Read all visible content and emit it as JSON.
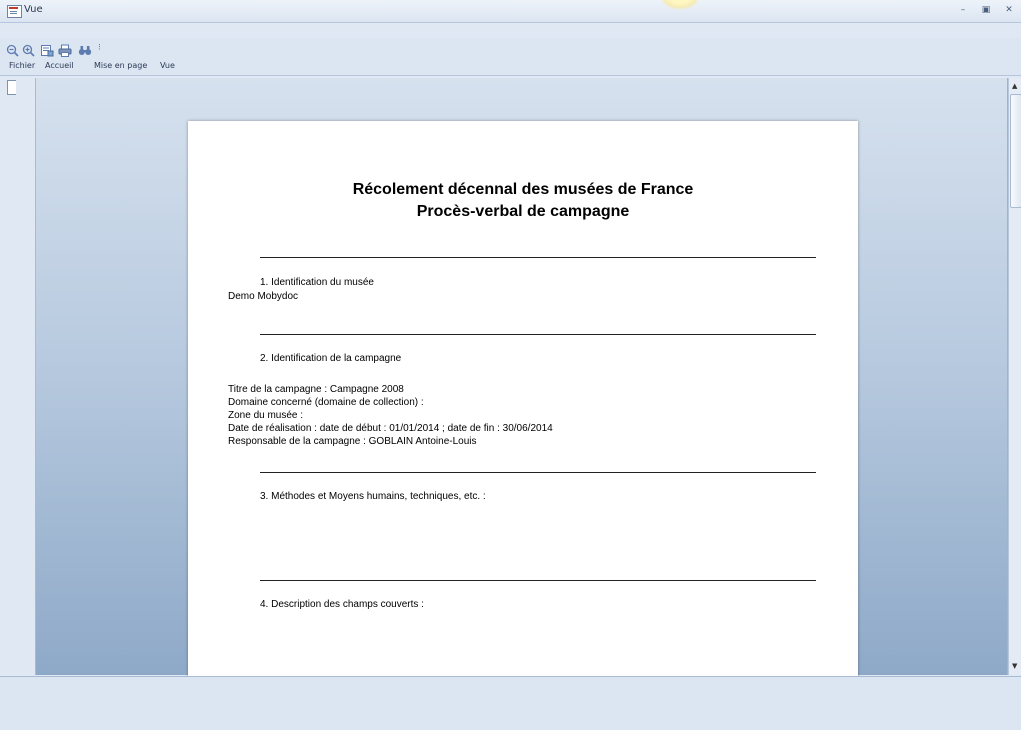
{
  "window": {
    "title": "Vue"
  },
  "titlebar": {
    "minimize_label": "–",
    "maximize_label": "▣",
    "close_label": "✕"
  },
  "toolbar": {
    "icons": [
      "zoom-out-icon",
      "zoom-in-icon",
      "page-setup-icon",
      "print-icon",
      "find-icon"
    ],
    "overflow_label": "⁝"
  },
  "menu": {
    "items": [
      "Fichier",
      "Accueil",
      "Mise en page",
      "Vue"
    ]
  },
  "document": {
    "title_line1": "Récolement décennal des musées de France",
    "title_line2": "Procès-verbal de campagne",
    "section1": {
      "heading": "1. Identification du musée",
      "value": "Demo Mobydoc"
    },
    "section2": {
      "heading": "2. Identification de la campagne",
      "lines": [
        "Titre de la campagne : Campagne 2008",
        "Domaine concerné (domaine de collection) :",
        "Zone du musée :",
        "Date de réalisation : date de début : 01/01/2014 ; date de fin : 30/06/2014",
        "Responsable de la campagne : GOBLAIN Antoine-Louis"
      ]
    },
    "section3": {
      "heading": "3. Méthodes et Moyens humains, techniques, etc. :"
    },
    "section4": {
      "heading": "4. Description des champs couverts :"
    }
  },
  "scrollbar": {
    "up_arrow": "▲",
    "down_arrow": "▼"
  },
  "colors": {
    "accent": "#dce6f2",
    "workspace_top": "#d6e1ee",
    "workspace_bottom": "#8ea9c8"
  }
}
